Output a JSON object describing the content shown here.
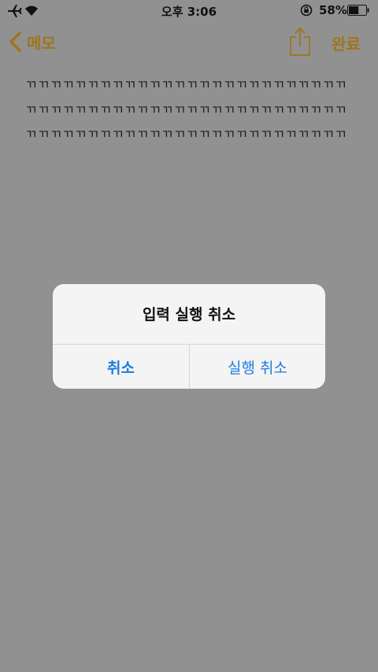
{
  "status_bar": {
    "time": "오후 3:06",
    "battery": "58%",
    "battery_fill_fraction": 0.58
  },
  "nav": {
    "back_label": "메모",
    "done_label": "완료"
  },
  "note": {
    "text": "ㄲㄲㄲㄲㄲㄲㄲㄲㄲㄲㄲㄲㄲㄲㄲㄲㄲㄲㄲㄲㄲㄲㄲㄲㄲㄲㄲㄲㄲㄲㄲㄲㄲㄲㄲㄲㄲㄲㄲㄲㄲㄲㄲㄲㄲㄲㄲㄲㄲㄲㄲㄲㄲㄲㄲㄲㄲㄲㄲㄲㄲㄲㄲㄲㄲㄲㄲㄲㄲㄲㄲㄲㄲㄲㄲㄲㄲㄲ"
  },
  "alert": {
    "title": "입력 실행 취소",
    "cancel_label": "취소",
    "redo_label": "실행 취소"
  },
  "colors": {
    "accent": "#a0751a",
    "alert_button": "#1d7ce0"
  }
}
